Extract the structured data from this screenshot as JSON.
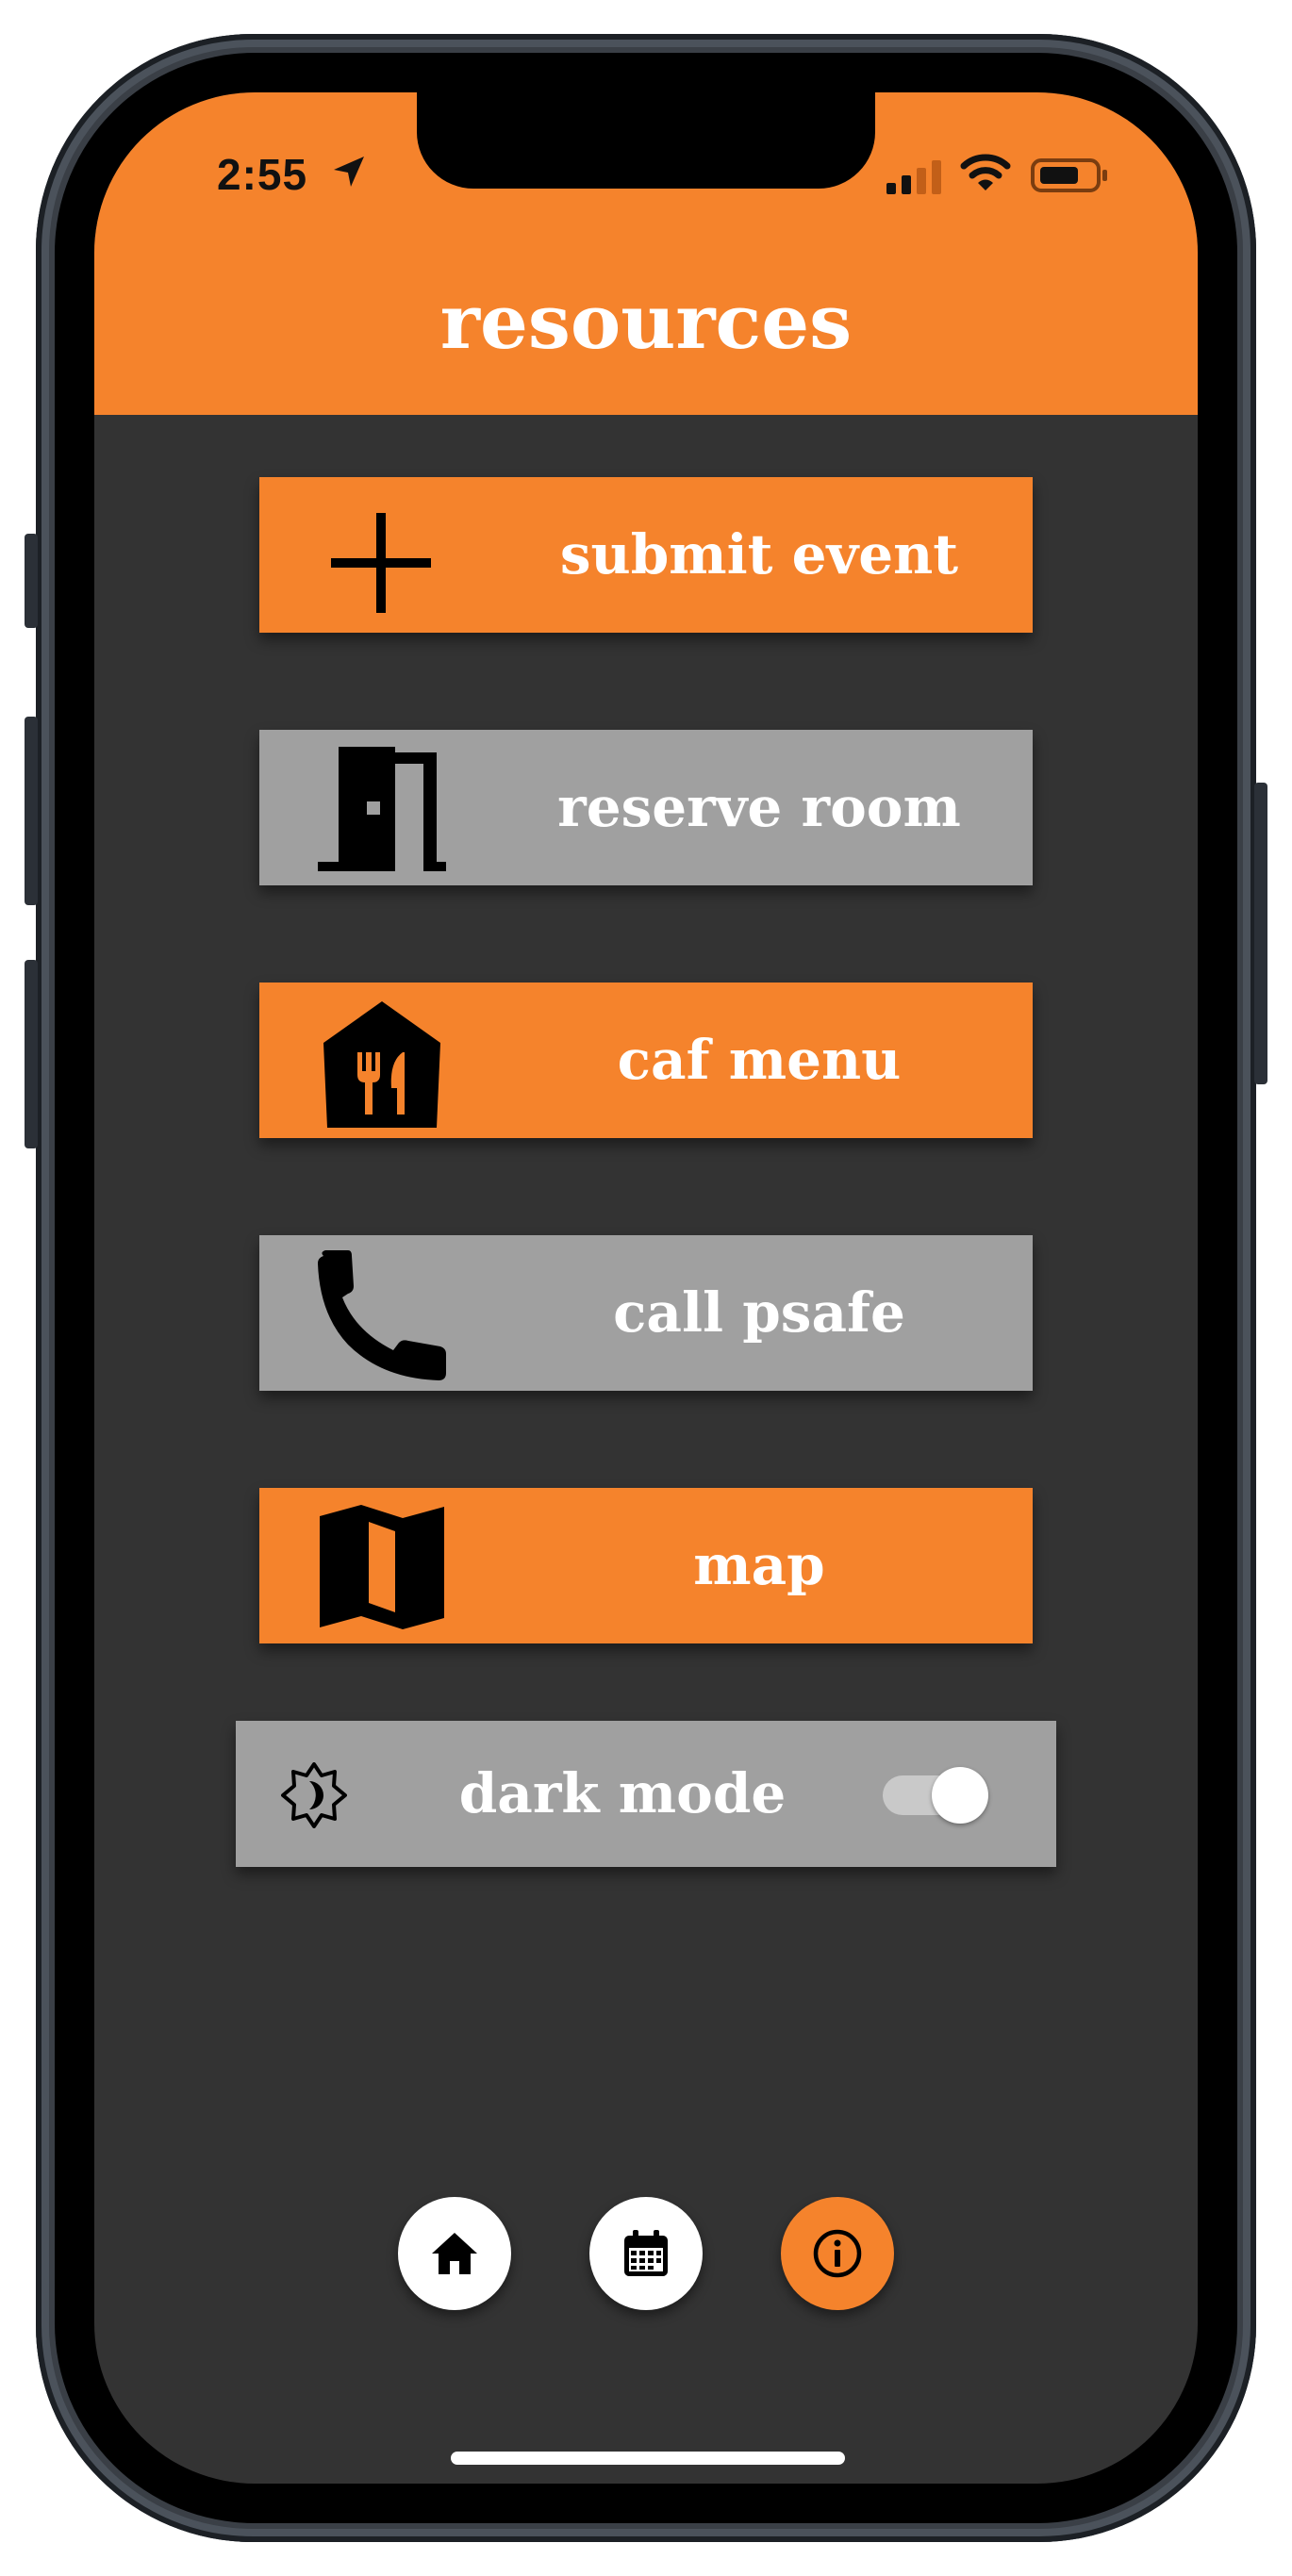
{
  "status_bar": {
    "time": "2:55",
    "icons": [
      "location-arrow-icon",
      "cellular-signal-icon",
      "wifi-icon",
      "battery-icon"
    ]
  },
  "header": {
    "title": "resources"
  },
  "buttons": [
    {
      "label": "submit event",
      "icon": "plus-icon",
      "color": "#f5832c"
    },
    {
      "label": "reserve room",
      "icon": "door-icon",
      "color": "#a0a0a0"
    },
    {
      "label": "caf menu",
      "icon": "restaurant-icon",
      "color": "#f5832c"
    },
    {
      "label": "call psafe",
      "icon": "phone-icon",
      "color": "#a0a0a0"
    },
    {
      "label": "map",
      "icon": "map-icon",
      "color": "#f5832c"
    }
  ],
  "dark_mode": {
    "label": "dark mode",
    "icon": "brightness-icon",
    "enabled": true
  },
  "tab_bar": {
    "items": [
      {
        "icon": "home-icon",
        "active": false
      },
      {
        "icon": "calendar-icon",
        "active": false
      },
      {
        "icon": "info-icon",
        "active": true
      }
    ]
  },
  "colors": {
    "accent": "#f5832c",
    "background": "#333333",
    "secondary": "#a0a0a0",
    "text": "#ffffff"
  }
}
